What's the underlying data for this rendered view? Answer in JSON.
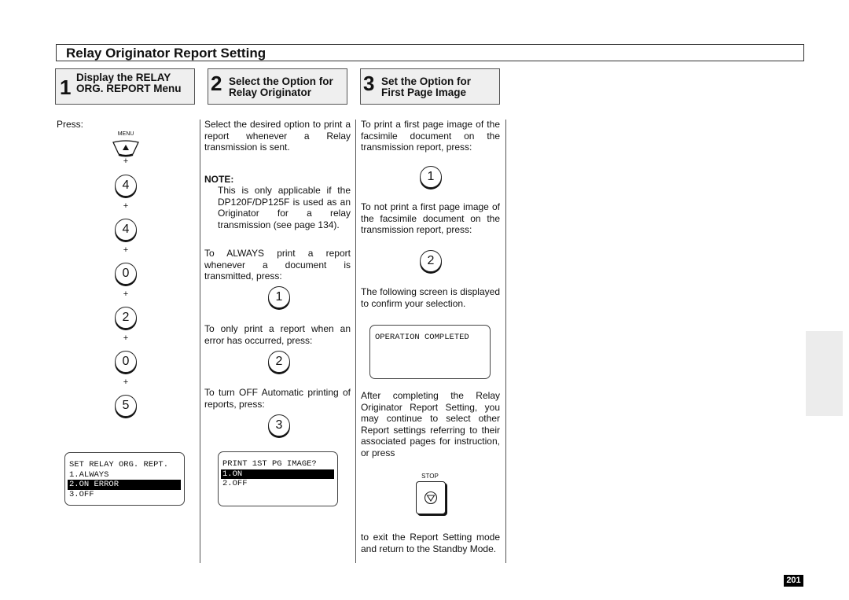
{
  "page_title": "Relay Originator Report Setting",
  "steps": [
    {
      "number": "1",
      "label": "Display the RELAY ORG. REPORT Menu"
    },
    {
      "number": "2",
      "label": "Select the Option for Relay Originator"
    },
    {
      "number": "3",
      "label": "Set the Option for First Page Image"
    }
  ],
  "col1": {
    "press_label": "Press:",
    "menu_key_label": "MENU",
    "key_sequence": [
      "4",
      "4",
      "0",
      "2",
      "0",
      "5"
    ],
    "plus": "+",
    "lcd": {
      "lines": [
        "SET RELAY ORG. REPT.",
        "1.ALWAYS",
        "2.ON ERROR",
        "3.OFF"
      ],
      "highlighted_index": 2
    }
  },
  "col2": {
    "intro": "Select the desired option to print a report whenever a Relay transmission is sent.",
    "note_label": "NOTE:",
    "note_text": "This is only applicable if the DP120F/DP125F is used as an Originator for a relay transmission (see page 134).",
    "always_text": "To ALWAYS print a report whenever a document is transmitted, press:",
    "always_key": "1",
    "error_text": "To only print a report when an error has occurred, press:",
    "error_key": "2",
    "off_text": "To turn OFF Automatic printing of reports, press:",
    "off_key": "3",
    "lcd": {
      "lines": [
        "PRINT 1ST PG IMAGE?",
        "1.ON",
        "2.OFF"
      ],
      "highlighted_index": 1
    }
  },
  "col3": {
    "print_text": "To print a first page image of the facsimile document on the transmission report, press:",
    "print_key": "1",
    "noprint_text": "To not print a first page image of the facsimile document on the transmission report, press:",
    "noprint_key": "2",
    "confirm_text": "The following screen is displayed to confirm your selection.",
    "lcd_text": "OPERATION COMPLETED",
    "after_text": "After completing the Relay Originator Report Setting, you may continue to select other Report settings referring to their associated pages for instruction, or press",
    "stop_key_label": "STOP",
    "exit_text": "to exit the Report Setting mode and return to the Standby Mode."
  },
  "page_number": "201"
}
